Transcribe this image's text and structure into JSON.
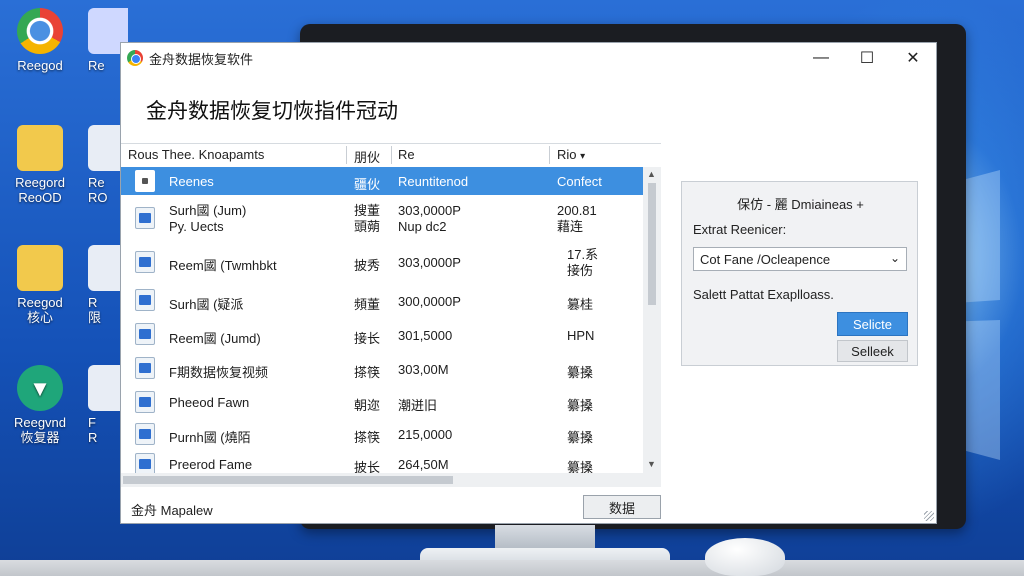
{
  "desktop": {
    "icons": [
      {
        "label": "Reegod",
        "icon": "chrome-icon"
      },
      {
        "label": "Re",
        "icon": "document-icon"
      },
      {
        "label": "Reegord\nReoOD",
        "icon": "folder-icon"
      },
      {
        "label": "Re\nRO",
        "icon": "document-icon"
      },
      {
        "label": "Reegod\n核心",
        "icon": "folder-icon"
      },
      {
        "label": "R\n限",
        "icon": "document-icon"
      },
      {
        "label": "Reegvnd\n恢复器",
        "icon": "shield-icon"
      },
      {
        "label": "F\nR",
        "icon": "document-icon"
      }
    ]
  },
  "window": {
    "title": "金舟数据恢复软件",
    "heading": "金舟数据恢复切恢指件冠动",
    "controls": {
      "minimize": "—",
      "maximize": "☐",
      "close": "✕"
    }
  },
  "table": {
    "columns": [
      "Rous Thee. Knoapamts",
      "朋伙",
      "Re",
      "Rio"
    ],
    "sort_indicator": "▾",
    "rows": [
      {
        "name": "Reenes",
        "type": "疆伙",
        "size": "Reuntitenod",
        "status": "Confect",
        "selected": true
      },
      {
        "name": "Surh國 (Jum)\nPy. Uects",
        "type": "搜董\n頭蒴",
        "size": "303,0000P\nNup dc2",
        "status": "200.81\n藉连",
        "selected": false
      },
      {
        "name": "Reem國 (Twmhbkt",
        "type": "披秀",
        "size": "303,0000P",
        "status": "17.系\n接伤",
        "selected": false
      },
      {
        "name": "Surh國 (疑派",
        "type": "頻董",
        "size": "300,0000P",
        "status": "篡桂",
        "selected": false
      },
      {
        "name": "Reem國 (Jumd)",
        "type": "接长",
        "size": "301,5000",
        "status": "HPN",
        "selected": false
      },
      {
        "name": "F期数据恢复视频",
        "type": "搽筷",
        "size": "303,00M",
        "status": "纂搡",
        "selected": false
      },
      {
        "name": "Pheeod Fawn",
        "type": "朝迩",
        "size": "潮迸旧",
        "status": "纂搡",
        "selected": false
      },
      {
        "name": "Purnh國 (燒陌",
        "type": "搽筷",
        "size": "215,0000",
        "status": "纂搡",
        "selected": false
      },
      {
        "name": "Preerod Fame",
        "type": "披长",
        "size": "264,50M",
        "status": "纂搡",
        "selected": false
      }
    ],
    "row_icon": "file-icon"
  },
  "panel": {
    "title": "保仿 - 麗 Dmiaineas +",
    "label": "Extrat Reenicer:",
    "select_value": "Cot Fane /Ocleapence",
    "note": "Salett Pattat Exaplloass.",
    "primary_button": "Selicte",
    "secondary_button": "Selleek"
  },
  "footer": {
    "label": "金舟 Mapalew",
    "button": "数据"
  },
  "colors": {
    "selection": "#3d8fe0",
    "desktop": "#1552b8"
  }
}
